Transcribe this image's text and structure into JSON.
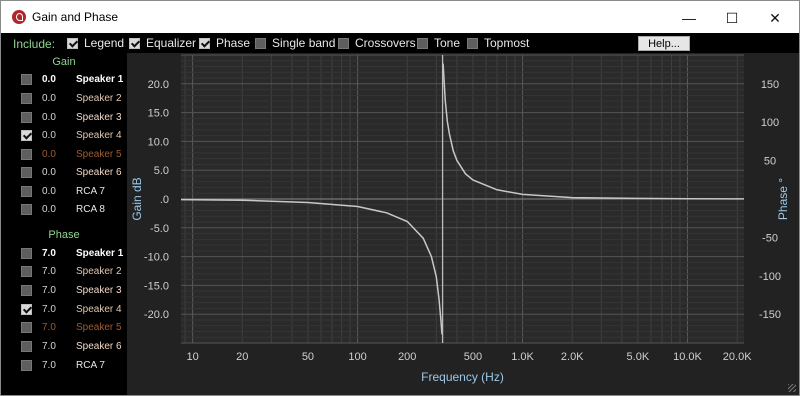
{
  "window": {
    "title": "Gain and Phase",
    "minimize": "—",
    "maximize": "☐",
    "close": "✕"
  },
  "toolbar": {
    "include_label": "Include:",
    "options": [
      {
        "label": "Legend",
        "checked": true
      },
      {
        "label": "Equalizer",
        "checked": true
      },
      {
        "label": "Phase",
        "checked": true
      },
      {
        "label": "Single band",
        "checked": false
      },
      {
        "label": "Crossovers",
        "checked": false
      },
      {
        "label": "Tone",
        "checked": false
      },
      {
        "label": "Topmost",
        "checked": false
      }
    ],
    "help_label": "Help..."
  },
  "gain": {
    "heading": "Gain",
    "rows": [
      {
        "value": "0.0",
        "name": "Speaker 1",
        "checked": false
      },
      {
        "value": "0.0",
        "name": "Speaker 2",
        "checked": false
      },
      {
        "value": "0.0",
        "name": "Speaker 3",
        "checked": false
      },
      {
        "value": "0.0",
        "name": "Speaker 4",
        "checked": true
      },
      {
        "value": "0.0",
        "name": "Speaker 5",
        "checked": false
      },
      {
        "value": "0.0",
        "name": "Speaker 6",
        "checked": false
      },
      {
        "value": "0.0",
        "name": "RCA 7",
        "checked": false
      },
      {
        "value": "0.0",
        "name": "RCA 8",
        "checked": false
      }
    ]
  },
  "phase": {
    "heading": "Phase",
    "rows": [
      {
        "value": "7.0",
        "name": "Speaker 1",
        "checked": false
      },
      {
        "value": "7.0",
        "name": "Speaker 2",
        "checked": false
      },
      {
        "value": "7.0",
        "name": "Speaker 3",
        "checked": false
      },
      {
        "value": "7.0",
        "name": "Speaker 4",
        "checked": true
      },
      {
        "value": "7.0",
        "name": "Speaker 5",
        "checked": false
      },
      {
        "value": "7.0",
        "name": "Speaker 6",
        "checked": false
      },
      {
        "value": "7.0",
        "name": "RCA 7",
        "checked": false
      }
    ]
  },
  "chart": {
    "gain_ticks": [
      "20.0",
      "15.0",
      "10.0",
      "5.0",
      ".0",
      "-5.0",
      "-10.0",
      "-15.0",
      "-20.0"
    ],
    "phase_ticks": [
      "150",
      "100",
      "50",
      "-50",
      "-100",
      "-150"
    ],
    "freq_ticks": [
      "10",
      "20",
      "50",
      "100",
      "200",
      "500",
      "1.0K",
      "2.0K",
      "5.0K",
      "10.0K",
      "20.0K"
    ],
    "xlabel": "Frequency (Hz)",
    "ylabel_left": "Gain dB",
    "ylabel_right": "Phase °"
  },
  "chart_data": {
    "type": "line",
    "xlabel": "Frequency (Hz)",
    "ylabel": "Gain dB",
    "y2label": "Phase °",
    "xscale": "log",
    "xlim": [
      8.5,
      22000
    ],
    "ylim": [
      -25,
      25
    ],
    "y2lim": [
      -187.5,
      187.5
    ],
    "grid": true,
    "series": [
      {
        "x": [
          8.5,
          20,
          50,
          100,
          150,
          200,
          250,
          280,
          300,
          312,
          320,
          325,
          330,
          340,
          350,
          360,
          380,
          400,
          450,
          500,
          700,
          1000,
          2000,
          5000,
          10000,
          20000,
          22000
        ],
        "y": [
          -0.1,
          -0.2,
          -0.6,
          -1.3,
          -2.4,
          -3.9,
          -6.8,
          -10,
          -13.5,
          -17.5,
          -21,
          -23.5,
          23.5,
          17,
          13.5,
          11.3,
          8.4,
          6.7,
          4.4,
          3.3,
          1.6,
          0.8,
          0.25,
          0.1,
          0.05,
          0.02,
          0.02
        ]
      }
    ]
  }
}
